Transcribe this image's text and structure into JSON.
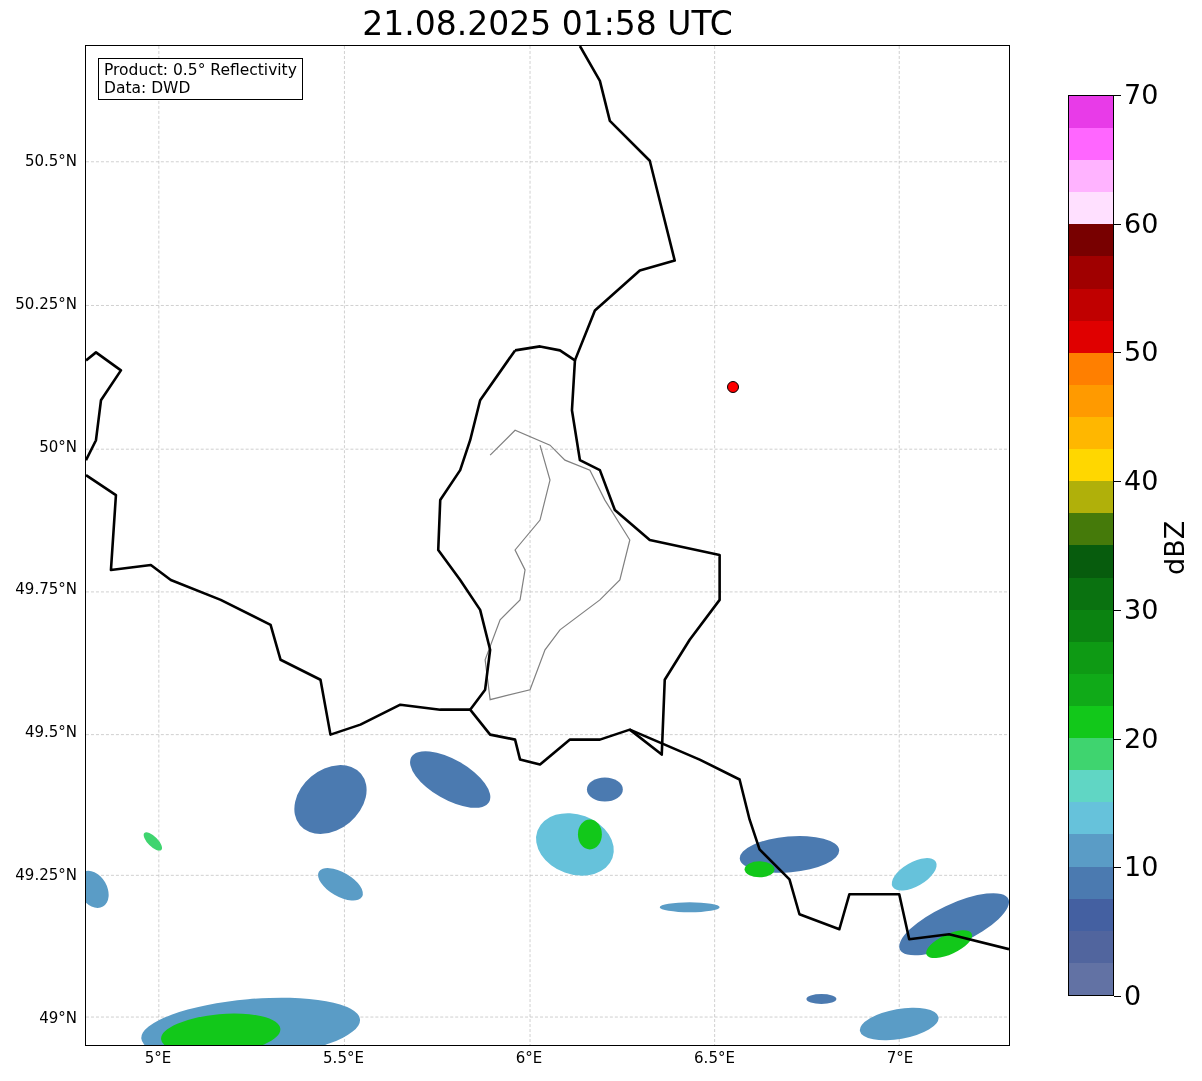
{
  "title": "21.08.2025 01:58 UTC",
  "legend": [
    "Product: 0.5° Reflectivity",
    "Data: DWD"
  ],
  "lat_ticks": [
    "50.5°N",
    "50.25°N",
    "50°N",
    "49.75°N",
    "49.5°N",
    "49.25°N",
    "49°N"
  ],
  "lon_ticks": [
    "5°E",
    "5.5°E",
    "6°E",
    "6.5°E",
    "7°E"
  ],
  "colorbar": {
    "label": "dBZ",
    "ticks": [
      "70",
      "60",
      "50",
      "40",
      "30",
      "20",
      "10",
      "0"
    ],
    "bands": [
      {
        "color": "#6272a4"
      },
      {
        "color": "#51659e"
      },
      {
        "color": "#4460a1"
      },
      {
        "color": "#4b7ab0"
      },
      {
        "color": "#5a9cc6"
      },
      {
        "color": "#66c2db"
      },
      {
        "color": "#60d6c4"
      },
      {
        "color": "#3fd46f"
      },
      {
        "color": "#12c81a"
      },
      {
        "color": "#10aa18"
      },
      {
        "color": "#0e9a14"
      },
      {
        "color": "#0b8311"
      },
      {
        "color": "#0a7210"
      },
      {
        "color": "#075c0d"
      },
      {
        "color": "#457a0a"
      },
      {
        "color": "#b0b00a"
      },
      {
        "color": "#ffd700"
      },
      {
        "color": "#ffb700"
      },
      {
        "color": "#ff9a00"
      },
      {
        "color": "#ff7f00"
      },
      {
        "color": "#e00000"
      },
      {
        "color": "#c00000"
      },
      {
        "color": "#a00000"
      },
      {
        "color": "#780000"
      },
      {
        "color": "#ffe0ff"
      },
      {
        "color": "#ffb3ff"
      },
      {
        "color": "#ff66ff"
      },
      {
        "color": "#e83be8"
      }
    ]
  }
}
